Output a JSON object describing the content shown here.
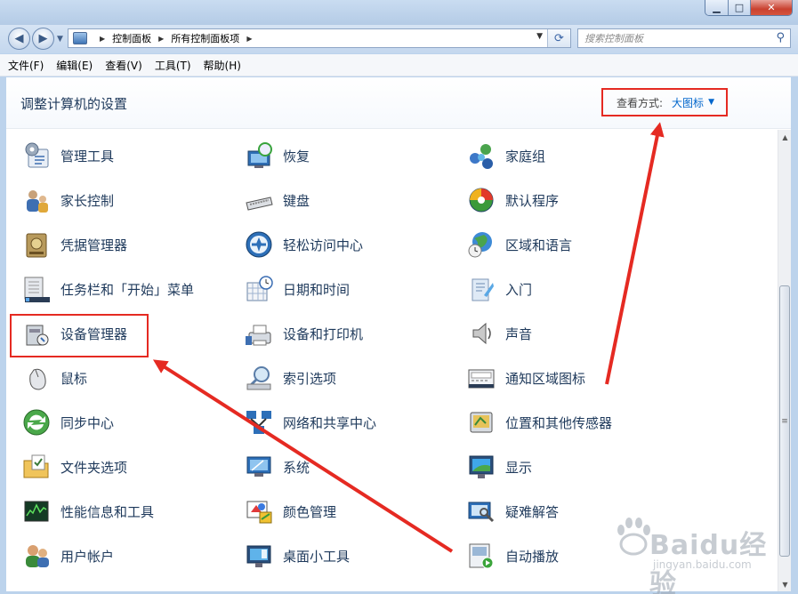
{
  "window": {
    "controls": {
      "minimize": "▁",
      "maximize": "□",
      "close": "✕"
    }
  },
  "nav": {
    "breadcrumb": [
      "控制面板",
      "所有控制面板项"
    ],
    "search_placeholder": "搜索控制面板"
  },
  "menu": [
    "文件(F)",
    "编辑(E)",
    "查看(V)",
    "工具(T)",
    "帮助(H)"
  ],
  "header": {
    "title": "调整计算机的设置",
    "view_by_label": "查看方式:",
    "view_by_value": "大图标"
  },
  "items": [
    {
      "label": "管理工具",
      "icon": "admin-tools-icon"
    },
    {
      "label": "恢复",
      "icon": "recovery-icon"
    },
    {
      "label": "家庭组",
      "icon": "homegroup-icon"
    },
    {
      "label": "家长控制",
      "icon": "parental-controls-icon"
    },
    {
      "label": "键盘",
      "icon": "keyboard-icon"
    },
    {
      "label": "默认程序",
      "icon": "default-programs-icon"
    },
    {
      "label": "凭据管理器",
      "icon": "credential-manager-icon"
    },
    {
      "label": "轻松访问中心",
      "icon": "ease-of-access-icon"
    },
    {
      "label": "区域和语言",
      "icon": "region-language-icon"
    },
    {
      "label": "任务栏和「开始」菜单",
      "icon": "taskbar-icon"
    },
    {
      "label": "日期和时间",
      "icon": "date-time-icon"
    },
    {
      "label": "入门",
      "icon": "getting-started-icon"
    },
    {
      "label": "设备管理器",
      "icon": "device-manager-icon"
    },
    {
      "label": "设备和打印机",
      "icon": "devices-printers-icon"
    },
    {
      "label": "声音",
      "icon": "sound-icon"
    },
    {
      "label": "鼠标",
      "icon": "mouse-icon"
    },
    {
      "label": "索引选项",
      "icon": "indexing-icon"
    },
    {
      "label": "通知区域图标",
      "icon": "notification-area-icon"
    },
    {
      "label": "同步中心",
      "icon": "sync-center-icon"
    },
    {
      "label": "网络和共享中心",
      "icon": "network-sharing-icon"
    },
    {
      "label": "位置和其他传感器",
      "icon": "location-sensors-icon"
    },
    {
      "label": "文件夹选项",
      "icon": "folder-options-icon"
    },
    {
      "label": "系统",
      "icon": "system-icon"
    },
    {
      "label": "显示",
      "icon": "display-icon"
    },
    {
      "label": "性能信息和工具",
      "icon": "performance-icon"
    },
    {
      "label": "颜色管理",
      "icon": "color-management-icon"
    },
    {
      "label": "疑难解答",
      "icon": "troubleshooting-icon"
    },
    {
      "label": "用户帐户",
      "icon": "user-accounts-icon"
    },
    {
      "label": "桌面小工具",
      "icon": "desktop-gadgets-icon"
    },
    {
      "label": "自动播放",
      "icon": "autoplay-icon"
    }
  ],
  "watermark": {
    "text": "Baidu经验",
    "sub": "jingyan.baidu.com"
  },
  "colors": {
    "accent": "#e52a22",
    "link": "#0066cc",
    "text": "#1e395b"
  }
}
